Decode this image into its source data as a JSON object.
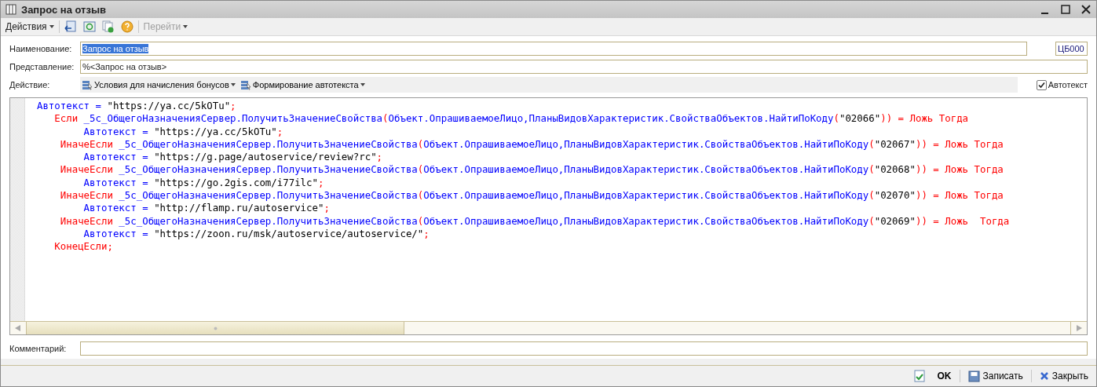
{
  "window": {
    "title": "Запрос на отзыв"
  },
  "toolbar": [
    {
      "kind": "menu",
      "label": "Действия",
      "disabled": false
    },
    {
      "kind": "import"
    },
    {
      "kind": "refresh"
    },
    {
      "kind": "copy"
    },
    {
      "kind": "help"
    },
    {
      "kind": "menu",
      "label": "Перейти",
      "disabled": true
    }
  ],
  "form": {
    "name": {
      "label": "Наименование:",
      "value": "Запрос на отзыв",
      "text_selected": true
    },
    "code": {
      "value": "ЦБ000"
    },
    "presentation": {
      "label": "Представление:",
      "value": "%<Запрос на отзыв>"
    },
    "action": {
      "label": "Действие:",
      "buttons": [
        "Условия для начисления бонусов",
        "Формирование автотекста"
      ]
    },
    "autotext": {
      "label": "Автотекст",
      "checked": true
    }
  },
  "code_lines": [
    [
      {
        "kind": "id",
        "t": "  Автотекст = "
      },
      {
        "kind": "str",
        "t": "\"https://ya.cc/5kOTu\""
      },
      {
        "kind": "kw",
        "t": ";"
      }
    ],
    [
      {
        "kind": "kw",
        "t": "     Если "
      },
      {
        "kind": "id",
        "t": "_5с_ОбщегоНазначенияСервер.ПолучитьЗначениеСвойства"
      },
      {
        "kind": "kw",
        "t": "("
      },
      {
        "kind": "id",
        "t": "Объект.ОпрашиваемоеЛицо,ПланыВидовХарактеристик.СвойстваОбъектов.НайтиПоКоду"
      },
      {
        "kind": "kw",
        "t": "("
      },
      {
        "kind": "str",
        "t": "\"02066\""
      },
      {
        "kind": "kw",
        "t": ")) = Ложь Тогда"
      }
    ],
    [
      {
        "kind": "id",
        "t": "          Автотекст = "
      },
      {
        "kind": "str",
        "t": "\"https://ya.cc/5kOTu\""
      },
      {
        "kind": "kw",
        "t": ";"
      }
    ],
    [
      {
        "kind": "kw",
        "t": "      ИначеЕсли "
      },
      {
        "kind": "id",
        "t": "_5с_ОбщегоНазначенияСервер.ПолучитьЗначениеСвойства"
      },
      {
        "kind": "kw",
        "t": "("
      },
      {
        "kind": "id",
        "t": "Объект.ОпрашиваемоеЛицо,ПланыВидовХарактеристик.СвойстваОбъектов.НайтиПоКоду"
      },
      {
        "kind": "kw",
        "t": "("
      },
      {
        "kind": "str",
        "t": "\"02067\""
      },
      {
        "kind": "kw",
        "t": ")) = Ложь Тогда"
      }
    ],
    [
      {
        "kind": "id",
        "t": "          Автотекст = "
      },
      {
        "kind": "str",
        "t": "\"https://g.page/autoservice/review?rc\""
      },
      {
        "kind": "kw",
        "t": ";"
      }
    ],
    [
      {
        "kind": "kw",
        "t": "      ИначеЕсли "
      },
      {
        "kind": "id",
        "t": "_5с_ОбщегоНазначенияСервер.ПолучитьЗначениеСвойства"
      },
      {
        "kind": "kw",
        "t": "("
      },
      {
        "kind": "id",
        "t": "Объект.ОпрашиваемоеЛицо,ПланыВидовХарактеристик.СвойстваОбъектов.НайтиПоКоду"
      },
      {
        "kind": "kw",
        "t": "("
      },
      {
        "kind": "str",
        "t": "\"02068\""
      },
      {
        "kind": "kw",
        "t": ")) = Ложь Тогда"
      }
    ],
    [
      {
        "kind": "id",
        "t": "          Автотекст = "
      },
      {
        "kind": "str",
        "t": "\"https://go.2gis.com/i77ilc\""
      },
      {
        "kind": "kw",
        "t": ";"
      }
    ],
    [
      {
        "kind": "kw",
        "t": "      ИначеЕсли "
      },
      {
        "kind": "id",
        "t": "_5с_ОбщегоНазначенияСервер.ПолучитьЗначениеСвойства"
      },
      {
        "kind": "kw",
        "t": "("
      },
      {
        "kind": "id",
        "t": "Объект.ОпрашиваемоеЛицо,ПланыВидовХарактеристик.СвойстваОбъектов.НайтиПоКоду"
      },
      {
        "kind": "kw",
        "t": "("
      },
      {
        "kind": "str",
        "t": "\"02070\""
      },
      {
        "kind": "kw",
        "t": ")) = Ложь Тогда"
      }
    ],
    [
      {
        "kind": "id",
        "t": "          Автотекст = "
      },
      {
        "kind": "str",
        "t": "\"http://flamp.ru/autoservice\""
      },
      {
        "kind": "kw",
        "t": ";"
      }
    ],
    [
      {
        "kind": "kw",
        "t": "      ИначеЕсли "
      },
      {
        "kind": "id",
        "t": "_5с_ОбщегоНазначенияСервер.ПолучитьЗначениеСвойства"
      },
      {
        "kind": "kw",
        "t": "("
      },
      {
        "kind": "id",
        "t": "Объект.ОпрашиваемоеЛицо,ПланыВидовХарактеристик.СвойстваОбъектов.НайтиПоКоду"
      },
      {
        "kind": "kw",
        "t": "("
      },
      {
        "kind": "str",
        "t": "\"02069\""
      },
      {
        "kind": "kw",
        "t": ")) = Ложь  Тогда"
      }
    ],
    [
      {
        "kind": "id",
        "t": "          Автотекст = "
      },
      {
        "kind": "str",
        "t": "\"https://zoon.ru/msk/autoservice/autoservice/\""
      },
      {
        "kind": "kw",
        "t": ";"
      }
    ],
    [
      {
        "kind": "kw",
        "t": "     КонецЕсли;"
      }
    ]
  ],
  "comment": {
    "label": "Комментарий:"
  },
  "buttons": [
    {
      "kind": "ok",
      "label": "OK"
    },
    {
      "kind": "save",
      "label": "Записать"
    },
    {
      "kind": "close",
      "label": "Закрыть"
    }
  ]
}
